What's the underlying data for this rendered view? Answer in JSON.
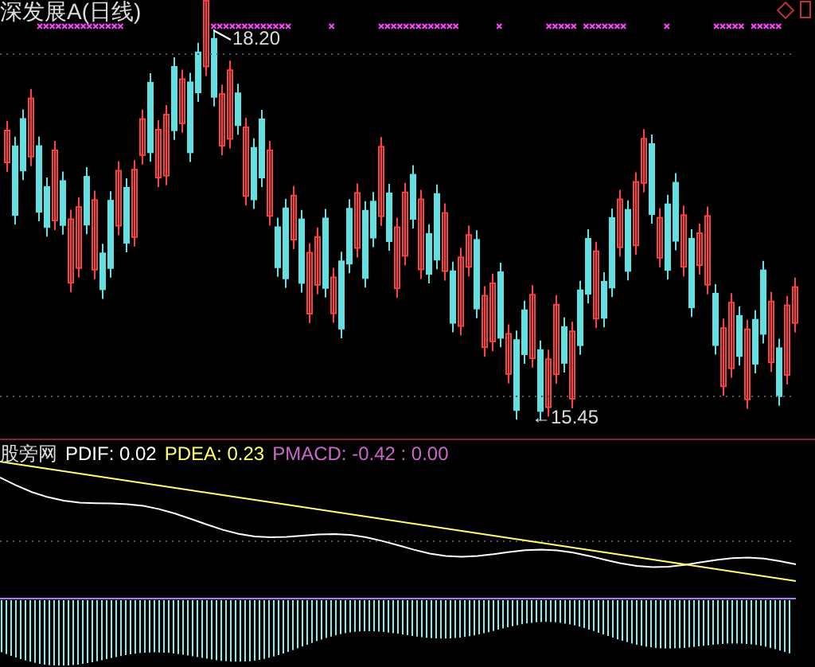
{
  "chart_title": "深发展A(日线)",
  "price_labels": [
    {
      "kind": "high",
      "text": "18.20"
    },
    {
      "kind": "low",
      "text": "←15.45"
    }
  ],
  "indicator": {
    "name": "股旁网",
    "values": [
      {
        "text": "PDIF: 0.02",
        "color": "#ffffff"
      },
      {
        "text": "PDEA: 0.23",
        "color": "#ffff66"
      },
      {
        "text": "PMACD: -0.42 : 0.00",
        "color": "#cc66cc"
      }
    ]
  }
}
